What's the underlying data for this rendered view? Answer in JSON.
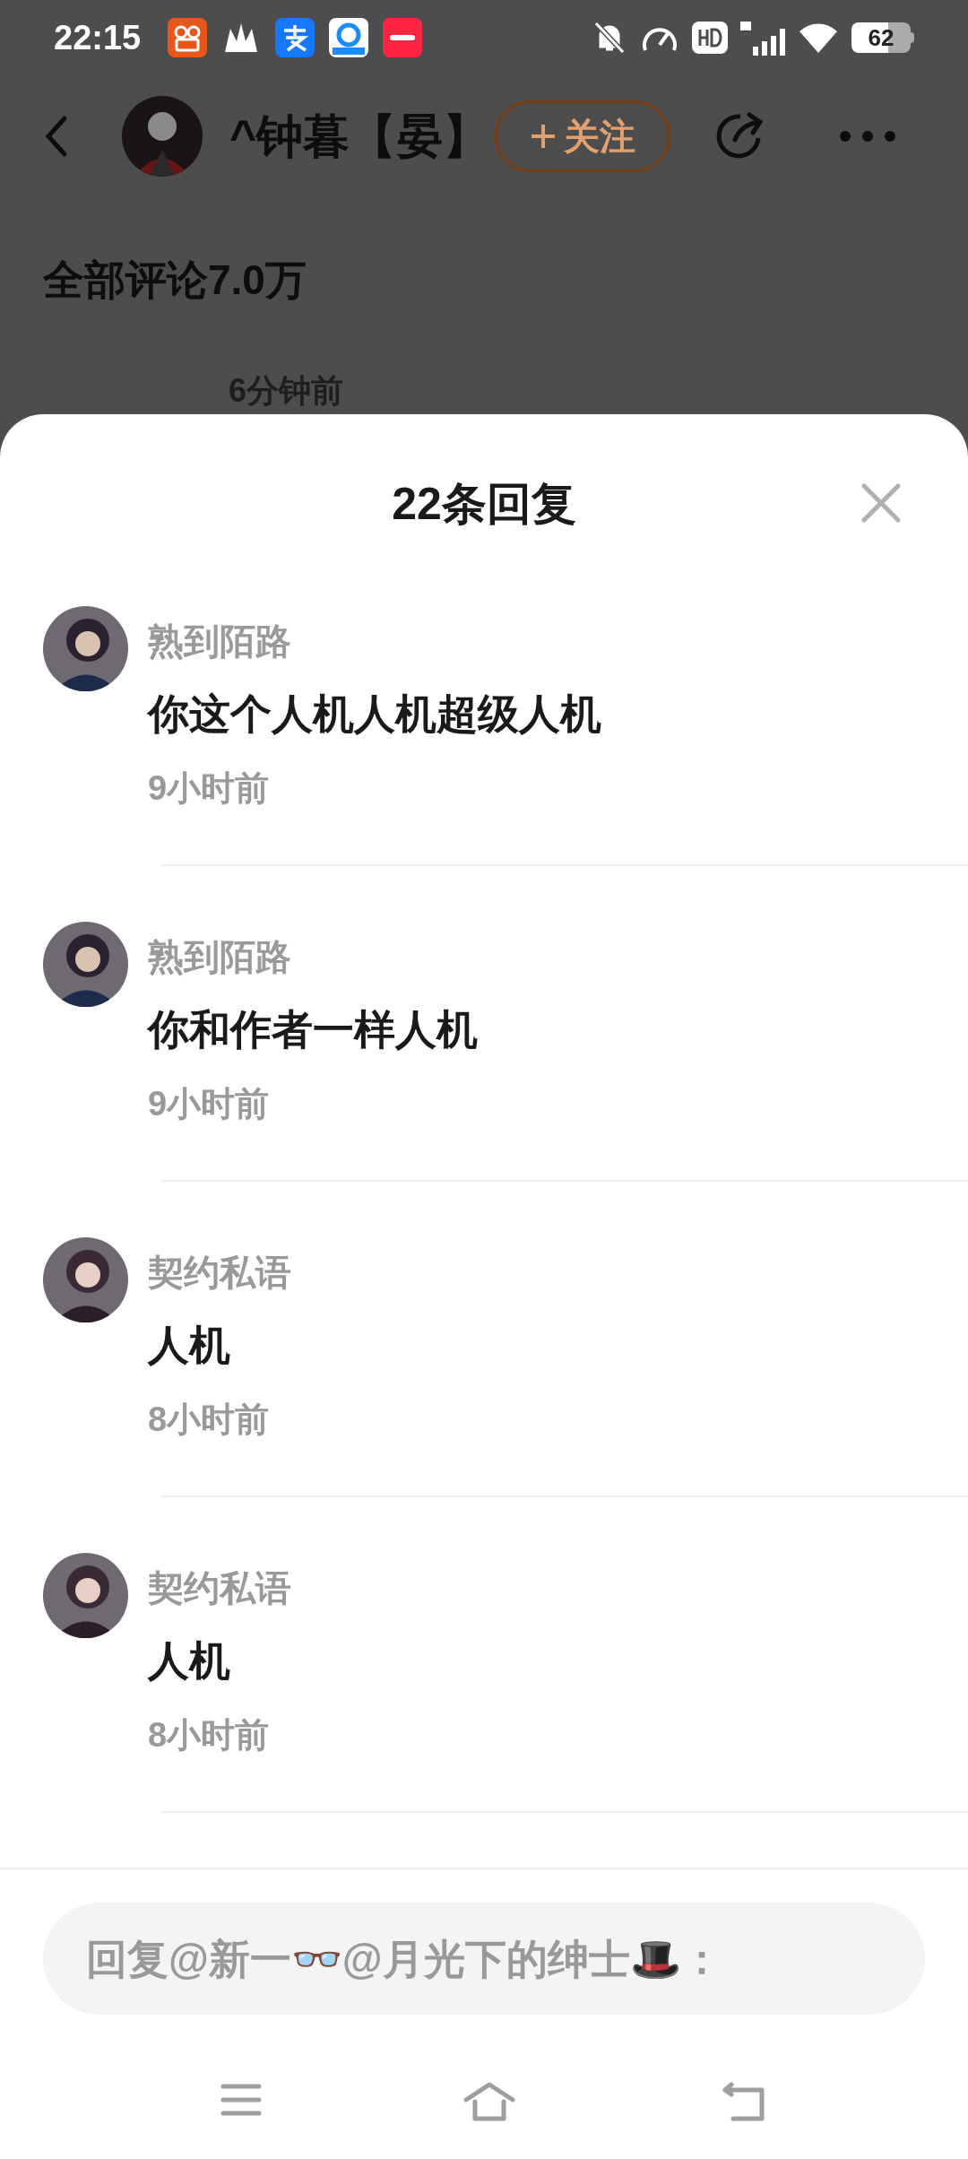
{
  "status_bar": {
    "time": "22:15",
    "battery": "62"
  },
  "header": {
    "user_name": "^钟暮【晏】",
    "follow_button": "关注"
  },
  "comments_heading": "全部评论7.0万",
  "behind_time": "6分钟前",
  "sheet": {
    "title": "22条回复",
    "replies": [
      {
        "author": "熟到陌路",
        "text": "你这个人机人机超级人机",
        "time": "9小时前"
      },
      {
        "author": "熟到陌路",
        "text": "你和作者一样人机",
        "time": "9小时前"
      },
      {
        "author": "契约私语",
        "text": "人机",
        "time": "8小时前"
      },
      {
        "author": "契约私语",
        "text": "人机",
        "time": "8小时前"
      }
    ],
    "reply_field": {
      "placeholder": "回复@新一👓@月光下的绅士🎩："
    }
  }
}
